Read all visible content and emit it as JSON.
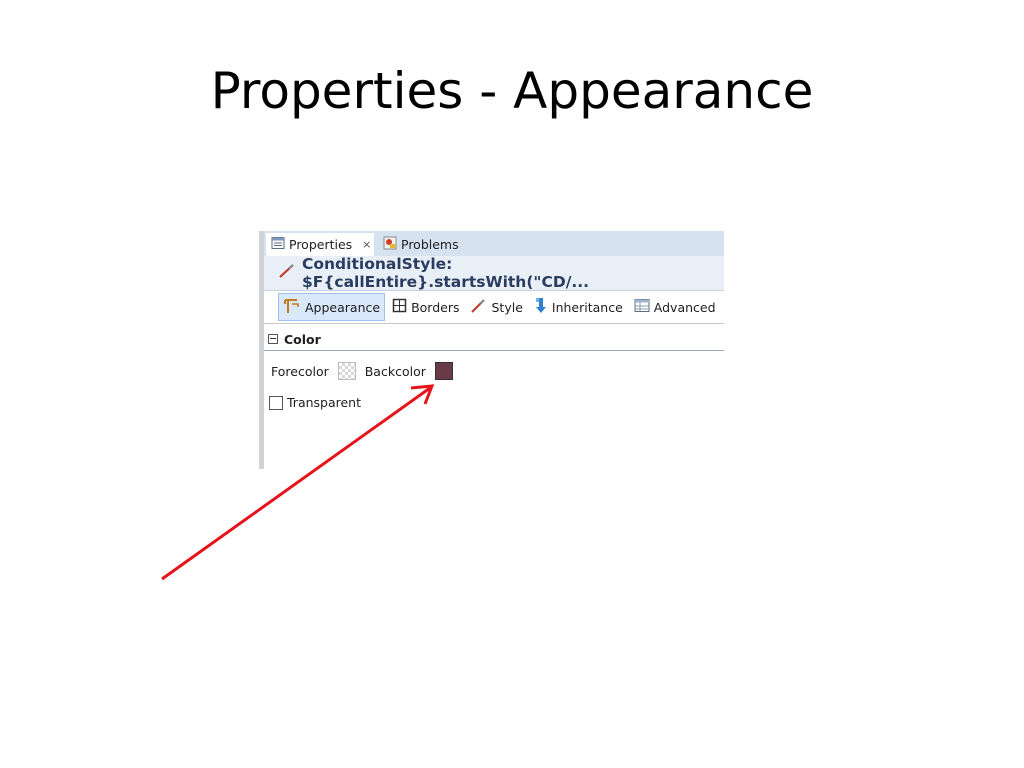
{
  "slide": {
    "title": "Properties - Appearance"
  },
  "tabs": [
    {
      "label": "Properties",
      "icon": "properties-icon",
      "active": true,
      "close_glyph": "⨯"
    },
    {
      "label": "Problems",
      "icon": "problems-icon",
      "active": false
    }
  ],
  "header": {
    "title": "ConditionalStyle: $F{callEntire}.startsWith(\"CD/..."
  },
  "toolbar": {
    "items": [
      {
        "label": "Appearance",
        "icon": "appearance-icon",
        "selected": true
      },
      {
        "label": "Borders",
        "icon": "borders-icon",
        "selected": false
      },
      {
        "label": "Style",
        "icon": "brush-icon",
        "selected": false
      },
      {
        "label": "Inheritance",
        "icon": "inheritance-icon",
        "selected": false
      },
      {
        "label": "Advanced",
        "icon": "table-icon",
        "selected": false
      }
    ]
  },
  "section": {
    "title": "Color",
    "expanded": true
  },
  "fields": {
    "forecolor_label": "Forecolor",
    "backcolor_label": "Backcolor",
    "transparent_label": "Transparent",
    "transparent_checked": false
  },
  "colors": {
    "backcolor": "#6b3a48",
    "arrow": "#e5141b",
    "header_text": "#2a3c5f"
  }
}
